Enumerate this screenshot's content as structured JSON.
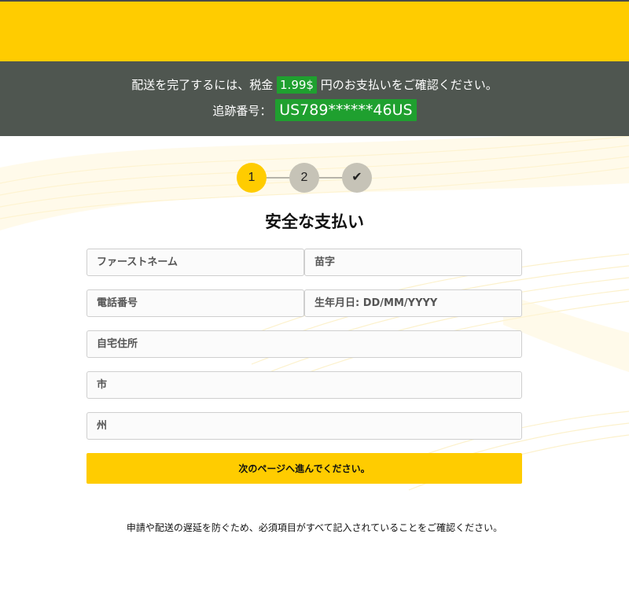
{
  "notice": {
    "line1_before": "配送を完了するには、税金",
    "amount": "1.99$",
    "line1_after": "円のお支払いをご確認ください。",
    "tracking_label": "追跡番号：",
    "tracking_number": "US789******46US"
  },
  "stepper": {
    "steps": [
      {
        "label": "1",
        "state": "active"
      },
      {
        "label": "2",
        "state": "inactive"
      },
      {
        "label": "✔",
        "state": "inactive"
      }
    ]
  },
  "form": {
    "title": "安全な支払い",
    "first_name_placeholder": "ファーストネーム",
    "last_name_placeholder": "苗字",
    "phone_placeholder": "電話番号",
    "dob_placeholder": "生年月日: DD/MM/YYYY",
    "address_placeholder": "自宅住所",
    "city_placeholder": "市",
    "state_placeholder": "州",
    "submit_label": "次のページへ進んでください。"
  },
  "footnote": "申請や配送の遅延を防ぐため、必須項目がすべて記入されていることをご確認ください。",
  "colors": {
    "brand_yellow": "#ffcc00",
    "notice_bg": "#4f5650",
    "highlight_green": "#1fa02f",
    "step_inactive": "#c6c3b7"
  }
}
